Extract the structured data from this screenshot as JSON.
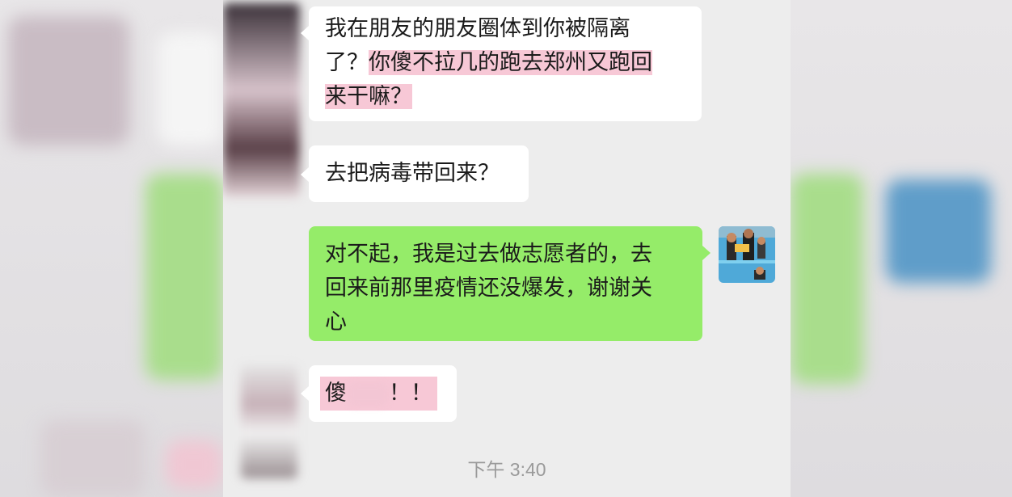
{
  "messages": [
    {
      "side": "incoming",
      "lines": [
        {
          "parts": [
            {
              "text": "我在朋友的朋友圈体到你被隔离",
              "highlight": false
            }
          ]
        },
        {
          "parts": [
            {
              "text": "了？",
              "highlight": false
            },
            {
              "text": "你傻不拉几的跑去郑州又跑回",
              "highlight": true
            }
          ]
        },
        {
          "parts": [
            {
              "text": "来干嘛？",
              "highlight": true
            }
          ]
        }
      ]
    },
    {
      "side": "incoming",
      "text": "去把病毒带回来？"
    },
    {
      "side": "outgoing",
      "lines": [
        "对不起，我是过去做志愿者的，去",
        "回来前那里疫情还没爆发，谢谢关",
        "心"
      ]
    },
    {
      "side": "incoming",
      "prefix": "傻",
      "suffix": "！！",
      "censored": true
    }
  ],
  "timestamp": "下午 3:40",
  "colors": {
    "chat_bg": "#ededed",
    "incoming_bubble": "#ffffff",
    "outgoing_bubble": "#95ec69",
    "highlight": "#f7c8d6",
    "timestamp_text": "#9a9a9a"
  }
}
